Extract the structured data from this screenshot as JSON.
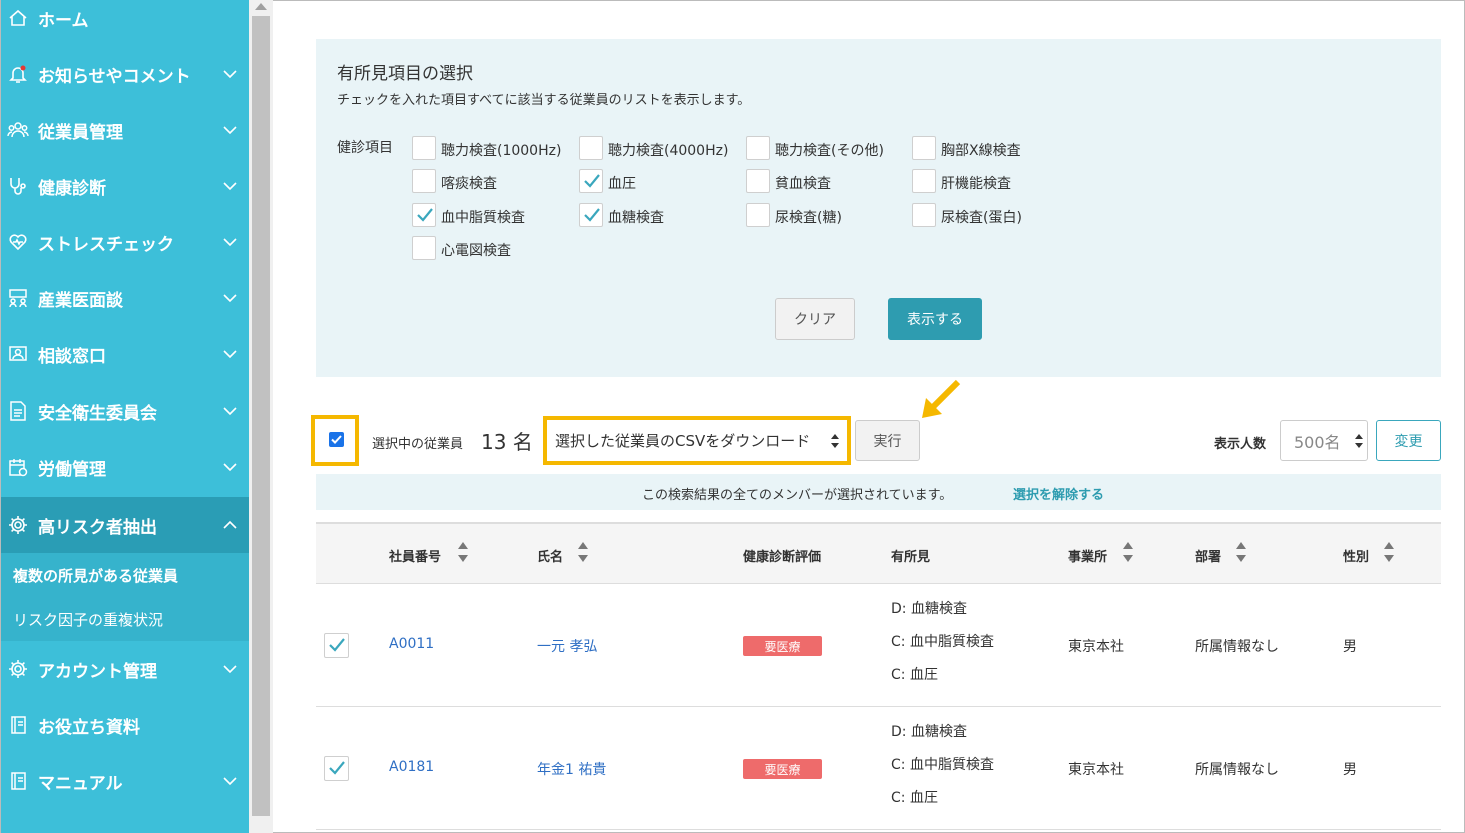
{
  "sidebar": {
    "items": [
      {
        "label": "ホーム",
        "icon": "home-icon"
      },
      {
        "label": "お知らせやコメント",
        "icon": "bell-icon"
      },
      {
        "label": "従業員管理",
        "icon": "users-icon"
      },
      {
        "label": "健康診断",
        "icon": "stethoscope-icon"
      },
      {
        "label": "ストレスチェック",
        "icon": "heart-icon"
      },
      {
        "label": "産業医面談",
        "icon": "meeting-icon"
      },
      {
        "label": "相談窓口",
        "icon": "consult-icon"
      },
      {
        "label": "安全衛生委員会",
        "icon": "document-icon"
      },
      {
        "label": "労働管理",
        "icon": "calendar-icon"
      },
      {
        "label": "高リスク者抽出",
        "icon": "gear-icon"
      },
      {
        "label": "アカウント管理",
        "icon": "gear-icon"
      },
      {
        "label": "お役立ち資料",
        "icon": "book-icon"
      },
      {
        "label": "マニュアル",
        "icon": "book-icon"
      }
    ],
    "subitems": [
      "複数の所見がある従業員",
      "リスク因子の重複状況"
    ]
  },
  "filter": {
    "title": "有所見項目の選択",
    "description": "チェックを入れた項目すべてに該当する従業員のリストを表示します。",
    "exam_label": "健診項目",
    "items": [
      {
        "label": "聴力検査(1000Hz)",
        "checked": false
      },
      {
        "label": "聴力検査(4000Hz)",
        "checked": false
      },
      {
        "label": "聴力検査(その他)",
        "checked": false
      },
      {
        "label": "胸部X線検査",
        "checked": false
      },
      {
        "label": "喀痰検査",
        "checked": false
      },
      {
        "label": "血圧",
        "checked": true
      },
      {
        "label": "貧血検査",
        "checked": false
      },
      {
        "label": "肝機能検査",
        "checked": false
      },
      {
        "label": "血中脂質検査",
        "checked": true
      },
      {
        "label": "血糖検査",
        "checked": true
      },
      {
        "label": "尿検査(糖)",
        "checked": false
      },
      {
        "label": "尿検査(蛋白)",
        "checked": false
      },
      {
        "label": "心電図検査",
        "checked": false
      }
    ],
    "clear_label": "クリア",
    "show_label": "表示する"
  },
  "actions": {
    "selected_label": "選択中の従業員",
    "selected_count": "13 名",
    "action_value": "選択した従業員のCSVをダウンロード",
    "exec_label": "実行",
    "display_label": "表示人数",
    "display_value": "500名",
    "change_label": "変更"
  },
  "notice": {
    "message": "この検索結果の全てのメンバーが選択されています。",
    "link": "選択を解除する"
  },
  "table": {
    "headers": [
      "社員番号",
      "氏名",
      "健康診断評価",
      "有所見",
      "事業所",
      "部署",
      "性別"
    ],
    "rows": [
      {
        "id": "A0011",
        "name": "一元 孝弘",
        "evaluation": "要医療",
        "findings": [
          "D: 血糖検査",
          "C: 血中脂質検査",
          "C: 血圧"
        ],
        "office": "東京本社",
        "dept": "所属情報なし",
        "gender": "男",
        "checked": true
      },
      {
        "id": "A0181",
        "name": "年金1 祐貴",
        "evaluation": "要医療",
        "findings": [
          "D: 血糖検査",
          "C: 血中脂質検査",
          "C: 血圧"
        ],
        "office": "東京本社",
        "dept": "所属情報なし",
        "gender": "男",
        "checked": true
      }
    ]
  },
  "colors": {
    "sidebar": "#3dbfd9",
    "accent": "#2e9cb0",
    "highlight": "#f5b800",
    "badge": "#ee6b6b"
  }
}
